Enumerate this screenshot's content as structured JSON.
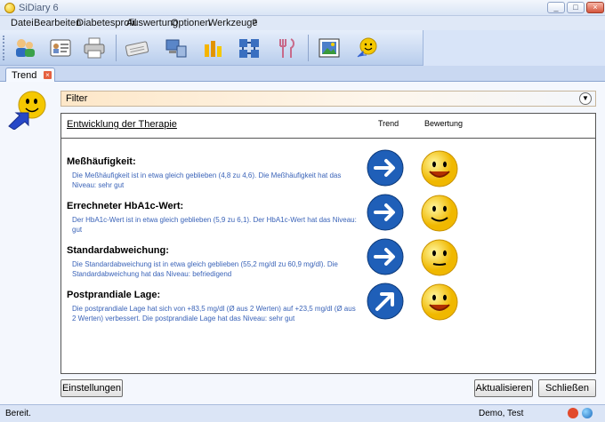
{
  "window": {
    "title": "SiDiary 6",
    "minimize": "_",
    "maximize": "□",
    "close": "×"
  },
  "menu": [
    "Datei",
    "Bearbeiten",
    "Diabetesprofil",
    "Auswertung",
    "Optionen",
    "Werkzeuge",
    "?"
  ],
  "toolbar": {
    "icons": [
      "people-icon",
      "id-card-icon",
      "printer-icon",
      "keyboard-icon",
      "computer-sync-icon",
      "chart-bars-icon",
      "network-icon",
      "cutlery-icon",
      "picture-icon",
      "smiley-arrow-icon"
    ]
  },
  "tab": {
    "label": "Trend",
    "close": "×"
  },
  "filter": {
    "label": "Filter"
  },
  "panel": {
    "title": "Entwicklung der Therapie",
    "trend_label": "Trend",
    "rating_label": "Bewertung"
  },
  "rows": [
    {
      "heading": "Meßhäufigkeit:",
      "description": "Die Meßhäufigkeit ist in etwa gleich geblieben (4,8 zu 4,6). Die Meßhäufigkeit hat das Niveau: sehr gut",
      "trend": "right",
      "rating": "very-good"
    },
    {
      "heading": "Errechneter HbA1c-Wert:",
      "description": "Der HbA1c-Wert ist in etwa gleich geblieben (5,9 zu 6,1). Der HbA1c-Wert hat das Niveau: gut",
      "trend": "right",
      "rating": "good"
    },
    {
      "heading": "Standardabweichung:",
      "description": "Die Standardabweichung ist in etwa gleich geblieben (55,2 mg/dl zu 60,9 mg/dl). Die Standardabweichung hat das Niveau: befriedigend",
      "trend": "right",
      "rating": "satisfactory"
    },
    {
      "heading": "Postprandiale Lage:",
      "description": "Die postprandiale Lage hat sich von +83,5 mg/dl (Ø aus 2 Werten) auf +23,5 mg/dl (Ø aus 2 Werten) verbessert. Die postprandiale Lage hat das Niveau: sehr gut",
      "trend": "up-right",
      "rating": "very-good"
    }
  ],
  "buttons": {
    "settings": "Einstellungen",
    "refresh": "Aktualisieren",
    "close": "Schließen"
  },
  "status": {
    "left": "Bereit.",
    "user": "Demo, Test"
  },
  "colors": {
    "arrow_blue": "#1f5fb8",
    "smiley_yellow": "#f5c800",
    "description_blue": "#3a63b8"
  }
}
